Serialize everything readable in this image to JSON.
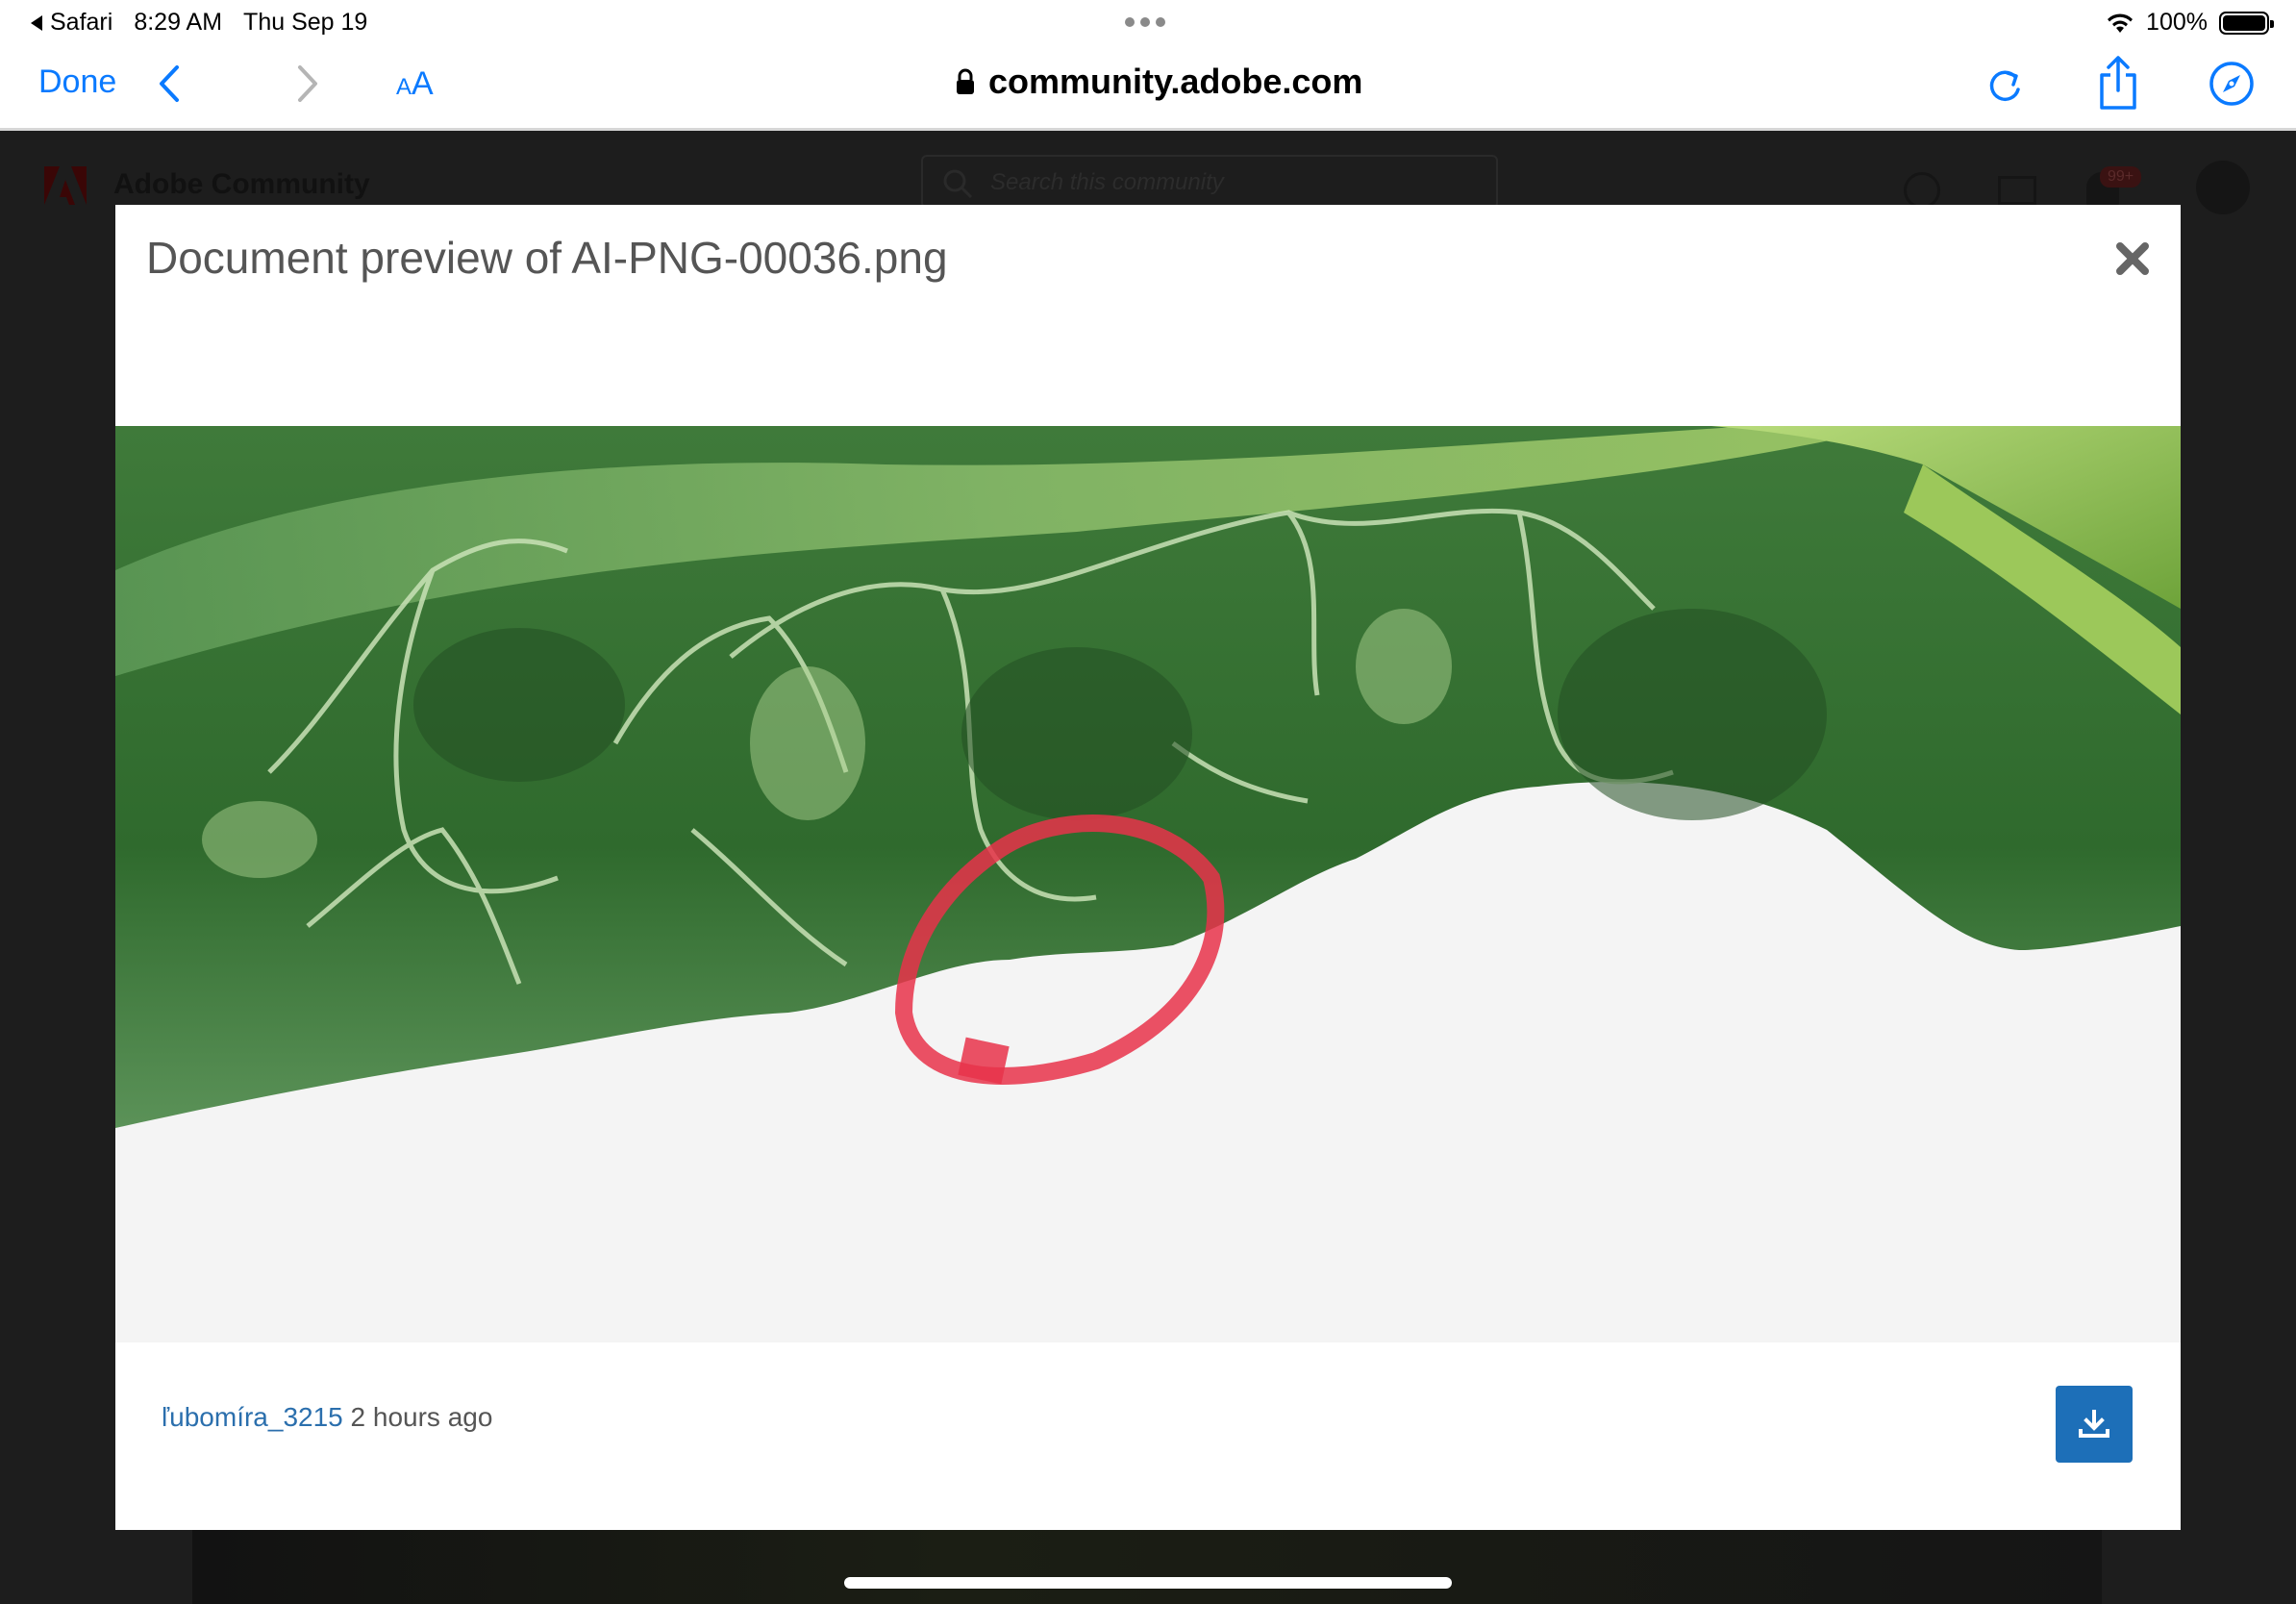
{
  "status_bar": {
    "back_app": "Safari",
    "time": "8:29 AM",
    "date": "Thu Sep 19",
    "battery_percent": "100%",
    "battery_level": 1.0
  },
  "toolbar": {
    "done_label": "Done",
    "text_size_label_small": "A",
    "text_size_label_large": "A",
    "url": "community.adobe.com",
    "icons": [
      "back-chevron-icon",
      "forward-chevron-icon",
      "lock-icon",
      "reload-icon",
      "share-icon",
      "compass-icon"
    ]
  },
  "background_page": {
    "site_title": "Adobe Community",
    "search_placeholder": "Search this community",
    "notification_badge": "99+"
  },
  "modal": {
    "title": "Document preview of AI-PNG-00036.png",
    "author": "ľubomíra_3215",
    "timestamp": "2 hours ago",
    "icons": [
      "close-icon",
      "download-icon"
    ]
  },
  "colors": {
    "ios_blue": "#0a7aff",
    "link_blue": "#2b6fad",
    "download_button": "#1d6fb8",
    "annotation_red": "#e8324a"
  }
}
